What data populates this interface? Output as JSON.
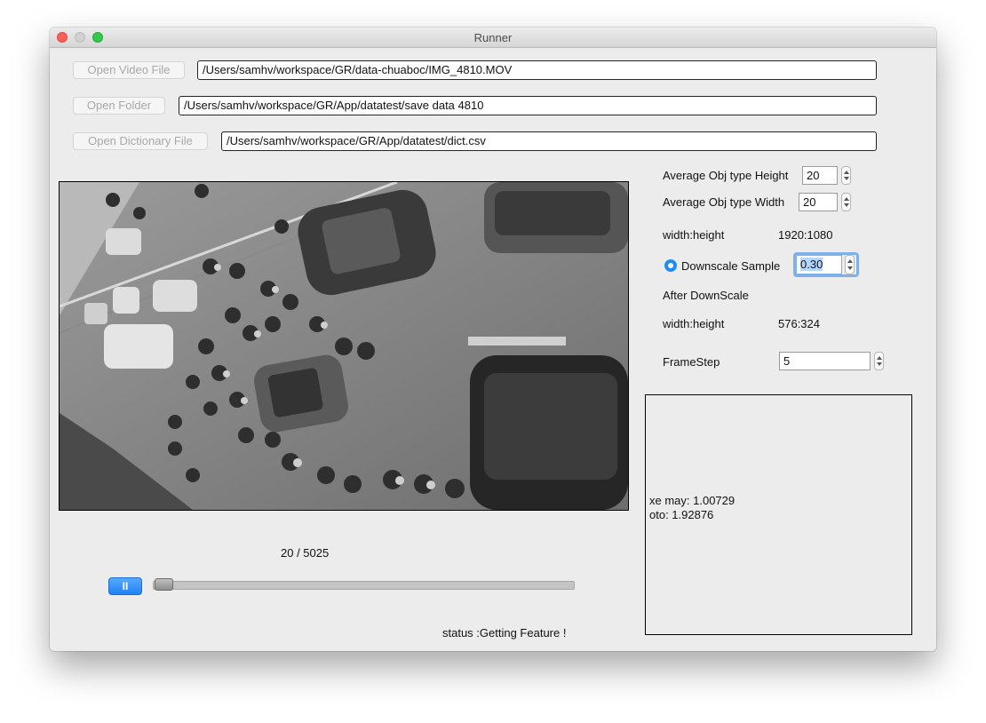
{
  "window": {
    "title": "Runner"
  },
  "files": {
    "open_video_label": "Open Video File",
    "video_path": "/Users/samhv/workspace/GR/data-chuaboc/IMG_4810.MOV",
    "open_folder_label": "Open Folder",
    "folder_path": "/Users/samhv/workspace/GR/App/datatest/save data 4810",
    "open_dictionary_label": "Open Dictionary File",
    "dictionary_path": "/Users/samhv/workspace/GR/App/datatest/dict.csv"
  },
  "settings": {
    "avg_height_label": "Average Obj type Height",
    "avg_height_value": "20",
    "avg_width_label": "Average Obj type Width",
    "avg_width_value": "20",
    "wh_label": "width:height",
    "wh_value": "1920:1080",
    "downscale_label": "Downscale Sample",
    "downscale_value": "0.30",
    "after_downscale_label": "After DownScale",
    "wh2_label": "width:height",
    "wh2_value": "576:324",
    "framestep_label": "FrameStep",
    "framestep_value": "5"
  },
  "output": {
    "lines": [
      "xe may: 1.00729",
      "oto: 1.92876"
    ]
  },
  "playback": {
    "frame_counter": "20 / 5025",
    "pause_symbol": "II",
    "progress": 0.004,
    "status": "status :Getting Feature !"
  },
  "colors": {
    "accent": "#1e8cf5",
    "window_bg": "#ececec"
  }
}
